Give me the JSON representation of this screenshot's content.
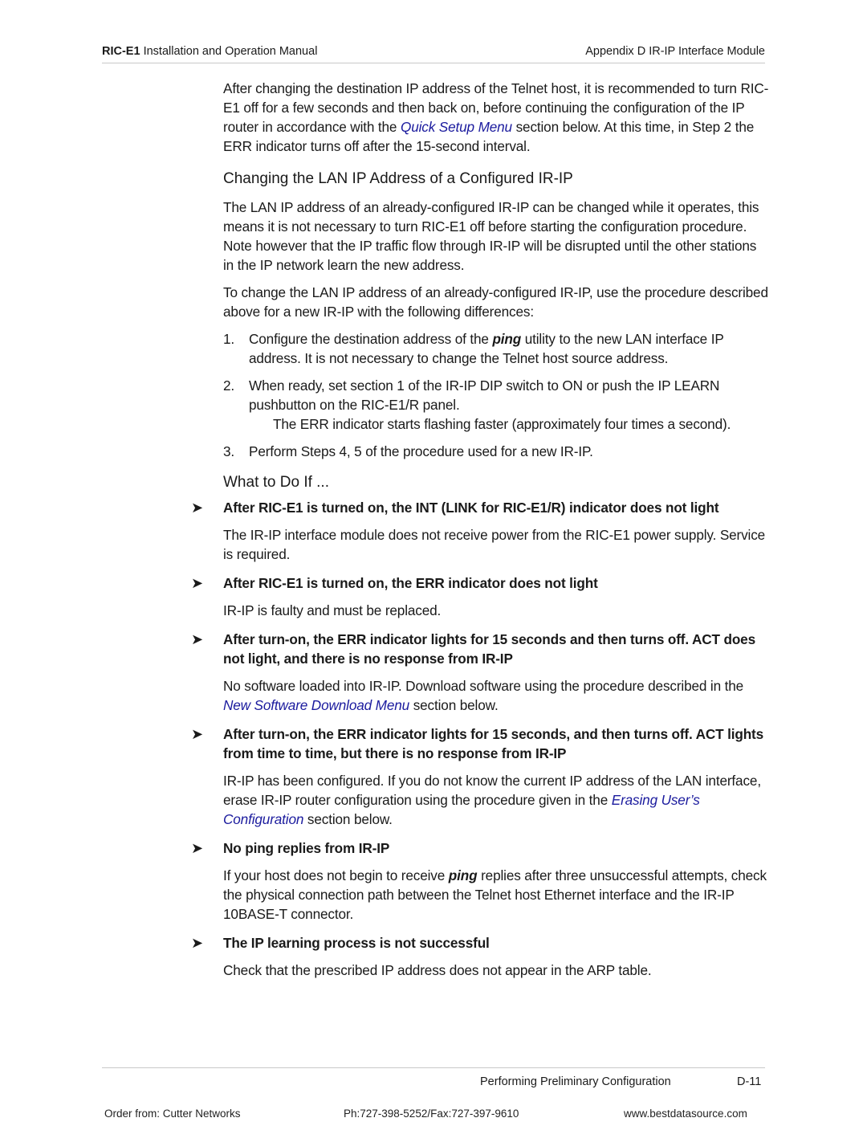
{
  "header": {
    "doc_bold": "RIC-E1",
    "doc_title": " Installation and Operation Manual",
    "appendix": "Appendix D  IR-IP Interface Module"
  },
  "intro": {
    "text1": "After changing the destination IP address of the Telnet host, it is recommended to turn RIC-E1 off for a few seconds and then back on, before continuing the configuration of the IP router in accordance with the ",
    "link": "Quick Setup Menu",
    "text2": " section below. At this time, in Step 2 the ERR indicator turns off after the 15-second interval."
  },
  "section_lan": {
    "heading": "Changing the LAN IP Address of a Configured IR-IP",
    "para1": "The LAN IP address of an already-configured IR-IP can be changed while it operates, this means it is not necessary to turn RIC-E1 off before starting the configuration procedure. Note however that the IP traffic flow through IR-IP will be disrupted until the other stations in the IP network learn the new address.",
    "para2": "To change the LAN IP address of an already-configured IR-IP, use the procedure described above for a new IR-IP with the following differences:",
    "steps": [
      {
        "num": "1.",
        "pre": "Configure the destination address of the ",
        "em": "ping",
        "post": " utility to the new LAN interface IP address. It is not necessary to change the Telnet host source address."
      },
      {
        "num": "2.",
        "text": "When ready, set section 1 of the IR-IP DIP switch to ON or push the IP LEARN pushbutton on the RIC-E1/R panel."
      },
      {
        "num": "3.",
        "text": "Perform Steps 4, 5 of the procedure used for a new IR-IP."
      }
    ],
    "step2_note": "The ERR indicator starts flashing faster (approximately four times a second)."
  },
  "section_whatif": {
    "heading": "What to Do If ...",
    "cases": [
      {
        "title": "After RIC-E1 is turned on, the INT (LINK for RIC-E1/R) indicator does not light",
        "body": "The IR-IP interface module does not receive power from the RIC-E1 power supply. Service is required."
      },
      {
        "title": "After RIC-E1 is turned on, the ERR indicator does not light",
        "body": "IR-IP is faulty and must be replaced."
      },
      {
        "title": "After turn-on, the ERR indicator lights for 15 seconds and then turns off. ACT does not light, and there is no response from IR-IP",
        "body_pre": "No software loaded into IR-IP. Download software using the procedure described in the ",
        "body_link": "New Software Download Menu",
        "body_post": " section below."
      },
      {
        "title": "After turn-on, the ERR indicator lights for 15 seconds, and then turns off. ACT lights from time to time, but there is no response from IR-IP",
        "body_pre": "IR-IP has been configured. If you do not know the current IP address of the LAN interface, erase IR-IP router configuration using the procedure given in the ",
        "body_link": "Erasing User’s Configuration",
        "body_post": " section below."
      },
      {
        "title": "No ping replies from IR-IP",
        "body_pre": "If your host does not begin to receive ",
        "body_em": "ping",
        "body_post": " replies after three unsuccessful attempts, check the physical connection path between the Telnet host Ethernet interface and the IR-IP 10BASE-T connector."
      },
      {
        "title": "The IP learning process is not successful",
        "body": "Check that the prescribed IP address does not appear in the ARP table."
      }
    ],
    "bullet_icon": "➤"
  },
  "footer": {
    "section": "Performing Preliminary Configuration",
    "page": "D-11",
    "order": "Order from: Cutter Networks",
    "phone": "Ph:727-398-5252/Fax:727-397-9610",
    "website": "www.bestdatasource.com"
  },
  "colors": {
    "link": "#1b1b9e",
    "rule": "#c8c8c8"
  }
}
